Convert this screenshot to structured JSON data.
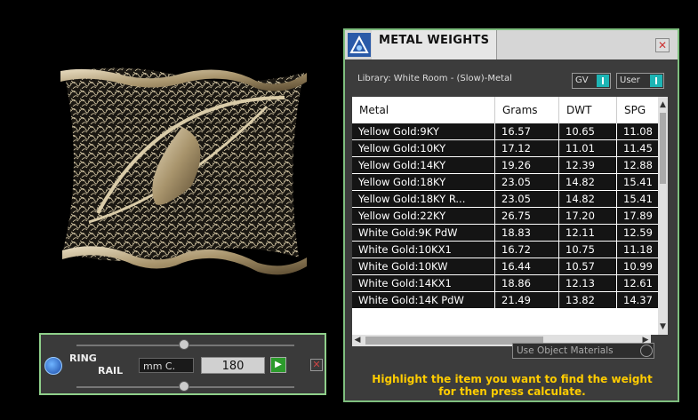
{
  "ring_rail": {
    "label_line1": "RING",
    "label_line2": "RAIL",
    "unit": "mm C.",
    "value": "180",
    "go_glyph": "▶",
    "close_glyph": "✕",
    "icon": "ring-rail-icon"
  },
  "metal_weights": {
    "title": "METAL WEIGHTS",
    "close_glyph": "✕",
    "library": "Library: White Room - (Slow)-Metal",
    "toggle_gv": "GV",
    "toggle_user": "User",
    "columns": [
      "Metal",
      "Grams",
      "DWT",
      "SPG"
    ],
    "rows": [
      [
        "Yellow Gold:9KY",
        "16.57",
        "10.65",
        "11.08"
      ],
      [
        "Yellow Gold:10KY",
        "17.12",
        "11.01",
        "11.45"
      ],
      [
        "Yellow Gold:14KY",
        "19.26",
        "12.39",
        "12.88"
      ],
      [
        "Yellow Gold:18KY",
        "23.05",
        "14.82",
        "15.41"
      ],
      [
        "Yellow Gold:18KY R...",
        "23.05",
        "14.82",
        "15.41"
      ],
      [
        "Yellow Gold:22KY",
        "26.75",
        "17.20",
        "17.89"
      ],
      [
        "White Gold:9K PdW",
        "18.83",
        "12.11",
        "12.59"
      ],
      [
        "White Gold:10KX1",
        "16.72",
        "10.75",
        "11.18"
      ],
      [
        "White Gold:10KW",
        "16.44",
        "10.57",
        "10.99"
      ],
      [
        "White Gold:14KX1",
        "18.86",
        "12.13",
        "12.61"
      ],
      [
        "White Gold:14K PdW",
        "21.49",
        "13.82",
        "14.37"
      ]
    ],
    "use_object_materials": "Use Object Materials",
    "hint_line1": "Highlight the item you want to find the weight",
    "hint_line2": "for then press calculate.",
    "accent": "#7fbf7f",
    "hint_color": "#ffcc00"
  }
}
